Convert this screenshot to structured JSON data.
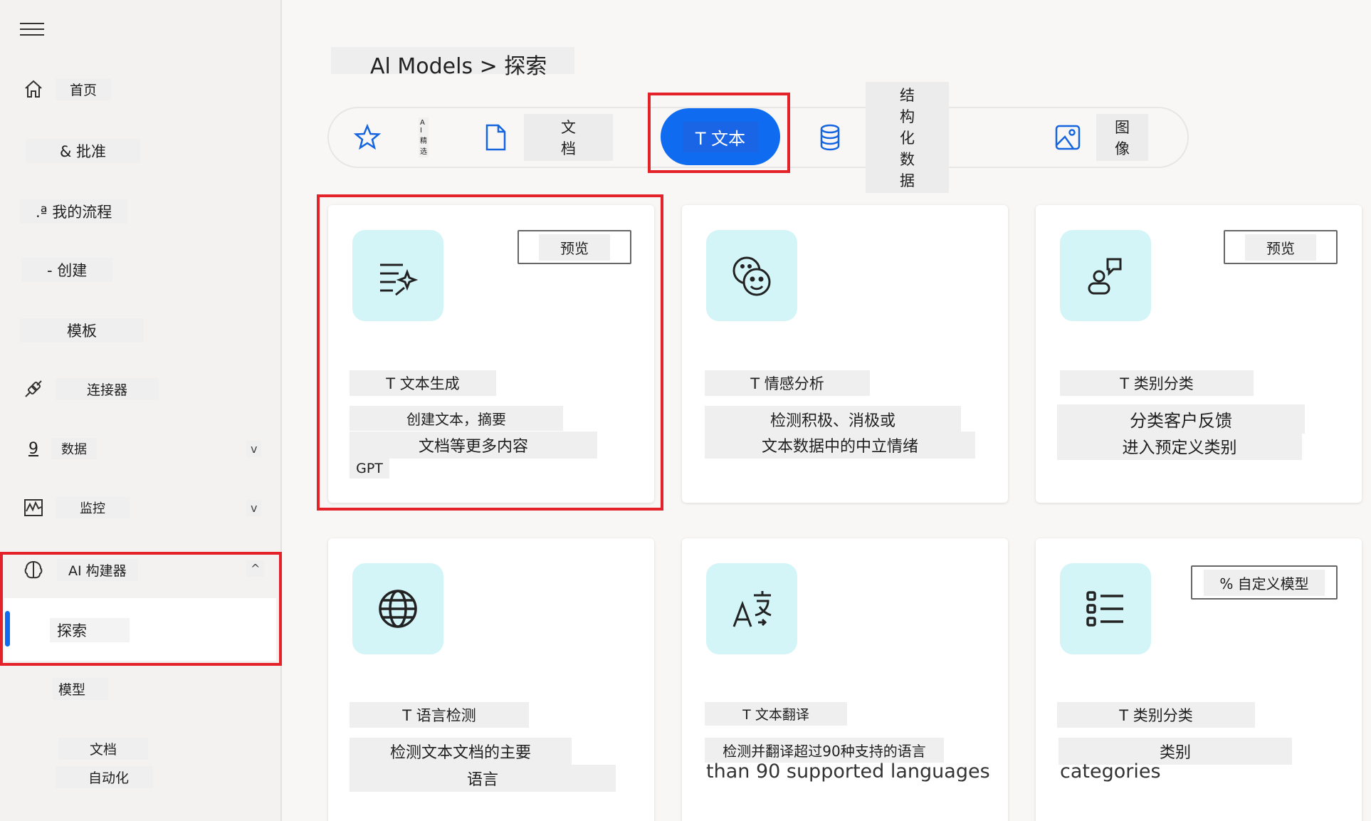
{
  "sidebar": {
    "items": [
      {
        "label": "首页",
        "icon": "home-icon"
      },
      {
        "label": "& 批准",
        "icon": ""
      },
      {
        "label": ".ª 我的流程",
        "icon": ""
      },
      {
        "label": "- 创建",
        "icon": ""
      },
      {
        "label": "模板",
        "icon": ""
      },
      {
        "label": "连接器",
        "icon": "connector-icon"
      },
      {
        "label": "数据",
        "icon": "data-icon",
        "icon_text": "9",
        "chevron": "v"
      },
      {
        "label": "监控",
        "icon": "monitor-icon",
        "chevron": "v"
      },
      {
        "label": "AI 构建器",
        "icon": "brain-icon",
        "chevron": "^"
      },
      {
        "label": "探索"
      },
      {
        "label": "模型"
      },
      {
        "label": "文档"
      },
      {
        "label": "自动化"
      }
    ]
  },
  "breadcrumb": "Al Models > 探索",
  "tabs": [
    {
      "label": "A I 精选",
      "icon": "star-icon"
    },
    {
      "label": "文档",
      "icon": "document-icon"
    },
    {
      "label": "T 文本",
      "icon": "text-icon",
      "active": true
    },
    {
      "label": "结构化数据",
      "icon": "database-icon"
    },
    {
      "label": "图像",
      "icon": "image-icon"
    }
  ],
  "cards": [
    {
      "title": "T 文本生成",
      "desc": [
        "创建文本，摘要",
        "文档等更多内容"
      ],
      "extra": "GPT",
      "badge": "预览",
      "icon": "text-sparkle-icon"
    },
    {
      "title": "T 情感分析",
      "desc": [
        "检测积极、消极或",
        "文本数据中的中立情绪"
      ],
      "icon": "emoji-icon"
    },
    {
      "title": "T 类别分类",
      "desc": [
        "分类客户反馈",
        "进入预定义类别"
      ],
      "badge": "预览",
      "icon": "people-chat-icon"
    },
    {
      "title": "T 语言检测",
      "desc": [
        "检测文本文档的主要",
        "语言"
      ],
      "icon": "globe-icon"
    },
    {
      "title": "T 文本翻译",
      "desc": [
        "检测并翻译超过90种支持的语言"
      ],
      "extra": "than 90 supported languages",
      "icon": "translate-icon"
    },
    {
      "title": "T 类别分类",
      "desc": [
        "类别"
      ],
      "extra": "categories",
      "badge": "% 自定义模型",
      "icon": "list-icon"
    }
  ],
  "colors": {
    "accent": "#0f6cf0",
    "highlight": "#e3222a",
    "icon_bg": "#d3f5f8"
  }
}
